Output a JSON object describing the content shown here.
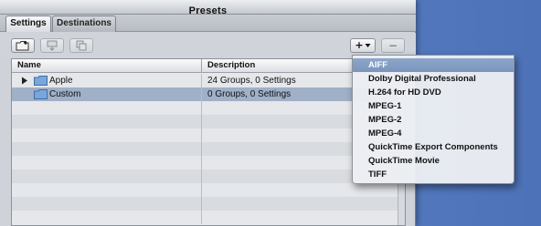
{
  "window": {
    "title": "Presets"
  },
  "tabs": [
    {
      "label": "Settings",
      "active": true
    },
    {
      "label": "Destinations",
      "active": false
    }
  ],
  "toolbar": {
    "buttons": [
      {
        "icon": "new-folder-icon",
        "enabled": true
      },
      {
        "icon": "apply-icon",
        "enabled": false
      },
      {
        "icon": "duplicate-icon",
        "enabled": false
      },
      {
        "label": "+",
        "icon": "chevron-down-icon",
        "enabled": true
      },
      {
        "label": "−",
        "enabled": false
      }
    ]
  },
  "table": {
    "columns": [
      "Name",
      "Description"
    ],
    "rows": [
      {
        "name": "Apple",
        "description": "24 Groups, 0 Settings",
        "expandable": true,
        "selected": false
      },
      {
        "name": "Custom",
        "description": "0 Groups, 0 Settings",
        "expandable": false,
        "selected": true
      }
    ]
  },
  "menu": {
    "items": [
      {
        "label": "AIFF",
        "highlighted": true
      },
      {
        "label": "Dolby Digital Professional"
      },
      {
        "label": "H.264 for HD DVD"
      },
      {
        "label": "MPEG-1"
      },
      {
        "label": "MPEG-2"
      },
      {
        "label": "MPEG-4"
      },
      {
        "label": "QuickTime Export Components"
      },
      {
        "label": "QuickTime Movie"
      },
      {
        "label": "TIFF"
      }
    ]
  },
  "colors": {
    "desktop": "#5a7fc2",
    "selection": "#9fb0c7",
    "menu_highlight": "#7a95bd"
  }
}
